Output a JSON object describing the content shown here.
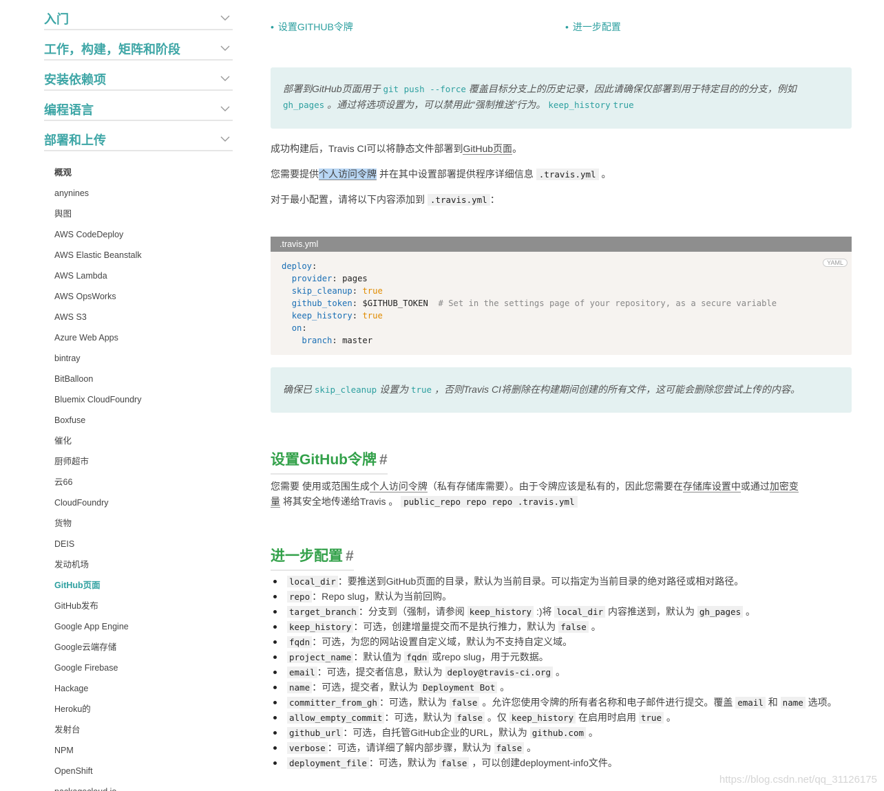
{
  "sidebar": {
    "sections": [
      "入门",
      "工作，构建，矩阵和阶段",
      "安装依赖项",
      "编程语言",
      "部署和上传"
    ],
    "items": [
      "概观",
      "anynines",
      "舆图",
      "AWS CodeDeploy",
      "AWS Elastic Beanstalk",
      "AWS Lambda",
      "AWS OpsWorks",
      "AWS S3",
      "Azure Web Apps",
      "bintray",
      "BitBalloon",
      "Bluemix CloudFoundry",
      "Boxfuse",
      "催化",
      "厨师超市",
      "云66",
      "CloudFoundry",
      "货物",
      "DEIS",
      "发动机场",
      "GitHub页面",
      "GitHub发布",
      "Google App Engine",
      "Google云端存储",
      "Google Firebase",
      "Hackage",
      "Heroku的",
      "发射台",
      "NPM",
      "OpenShift",
      "packagecloud.io"
    ],
    "active_item": "GitHub页面"
  },
  "toc": [
    "设置GITHUB令牌",
    "进一步配置"
  ],
  "note1": {
    "t1": "部署到GitHub页面用于",
    "c1": "git push --force",
    "t2": "覆盖目标分支上的历史记录，因此请确保仅部署到用于特定目的的分支，例如",
    "c2": "gh_pages",
    "t3": "。通过将选项设置为，可以禁用此“强制推送”行为。",
    "c3": "keep_history",
    "c4": "true"
  },
  "p1": {
    "t1": "成功构建后，Travis CI可以将静态文件部署到",
    "link": "GitHub页面",
    "t2": "。"
  },
  "p2": {
    "t1": "您需要提供",
    "link": "个人访问令牌",
    "t2": "并在其中设置部署提供程序详细信息",
    "c1": ".travis.yml",
    "t3": "。"
  },
  "p3": {
    "t1": "对于最小配置，请将以下内容添加到",
    "c1": ".travis.yml",
    "t2": "："
  },
  "code": {
    "caption": ".travis.yml",
    "lang": "YAML",
    "l1k": "deploy",
    "l2k": "provider",
    "l2v": "pages",
    "l3k": "skip_cleanup",
    "l3v": "true",
    "l4k": "github_token",
    "l4v": "$GITHUB_TOKEN",
    "l4c": "# Set in the settings page of your repository, as a secure variable",
    "l5k": "keep_history",
    "l5v": "true",
    "l6k": "on",
    "l7k": "branch",
    "l7v": "master"
  },
  "note2": {
    "t1": "确保已",
    "c1": "skip_cleanup",
    "t2": "设置为",
    "c2": "true",
    "t3": "，否则Travis CI将删除在构建期间创建的所有文件，这可能会删除您尝试上传的内容。"
  },
  "h_token": "设置GitHub令牌",
  "hash": "#",
  "p4": {
    "t1": "您需要 使用或范围生成",
    "link1": "个人访问令牌",
    "t2": "（私有存储库需要）。由于令牌应该是私有的，因此您需要在",
    "link2": "存储库设置中",
    "t3": "或通过",
    "link3a": "加密变",
    "link3b": "量",
    "t4": "将其安全地传递给Travis 。",
    "c1": "public_repo repo repo .travis.yml"
  },
  "h_config": "进一步配置",
  "options": [
    {
      "key": "local_dir",
      "text": "：要推送到GitHub页面的目录，默认为当前目录。可以指定为当前目录的绝对路径或相对路径。"
    },
    {
      "key": "repo",
      "text": "：Repo slug，默认为当前回购。"
    },
    {
      "key": "target_branch",
      "t1": "：分支到（强制，请参阅",
      "c1": "keep_history",
      "t2": ":)将",
      "c2": "local_dir",
      "t3": "内容推送到，默认为",
      "c3": "gh_pages",
      "t4": "。"
    },
    {
      "key": "keep_history",
      "t1": "：可选，创建增量提交而不是执行推力，默认为",
      "c1": "false",
      "t2": "。"
    },
    {
      "key": "fqdn",
      "text": "：可选，为您的网站设置自定义域，默认为不支持自定义域。"
    },
    {
      "key": "project_name",
      "t1": "：默认值为",
      "c1": "fqdn",
      "t2": "或repo slug，用于元数据。"
    },
    {
      "key": "email",
      "t1": "：可选，提交者信息，默认为",
      "c1": "deploy@travis-ci.org",
      "t2": "。"
    },
    {
      "key": "name",
      "t1": "：可选，提交者，默认为",
      "c1": "Deployment Bot",
      "t2": "。"
    },
    {
      "key": "committer_from_gh",
      "t1": "：可选，默认为",
      "c1": "false",
      "t2": "。允许您使用令牌的所有者名称和电子邮件进行提交。覆盖",
      "c2": "email",
      "t3": "和",
      "c3": "name",
      "t4": "选项。"
    },
    {
      "key": "allow_empty_commit",
      "t1": "：可选，默认为",
      "c1": "false",
      "t2": "。仅",
      "c2": "keep_history",
      "t3": "在启用时启用",
      "c3": "true",
      "t4": "。"
    },
    {
      "key": "github_url",
      "t1": "：可选，自托管GitHub企业的URL，默认为",
      "c1": "github.com",
      "t2": "。"
    },
    {
      "key": "verbose",
      "t1": "：可选，请详细了解内部步骤，默认为",
      "c1": "false",
      "t2": "。"
    },
    {
      "key": "deployment_file",
      "t1": "：可选，默认为",
      "c1": "false",
      "t2": "，可以创建deployment-info文件。"
    }
  ],
  "watermark": "https://blog.csdn.net/qq_31126175"
}
